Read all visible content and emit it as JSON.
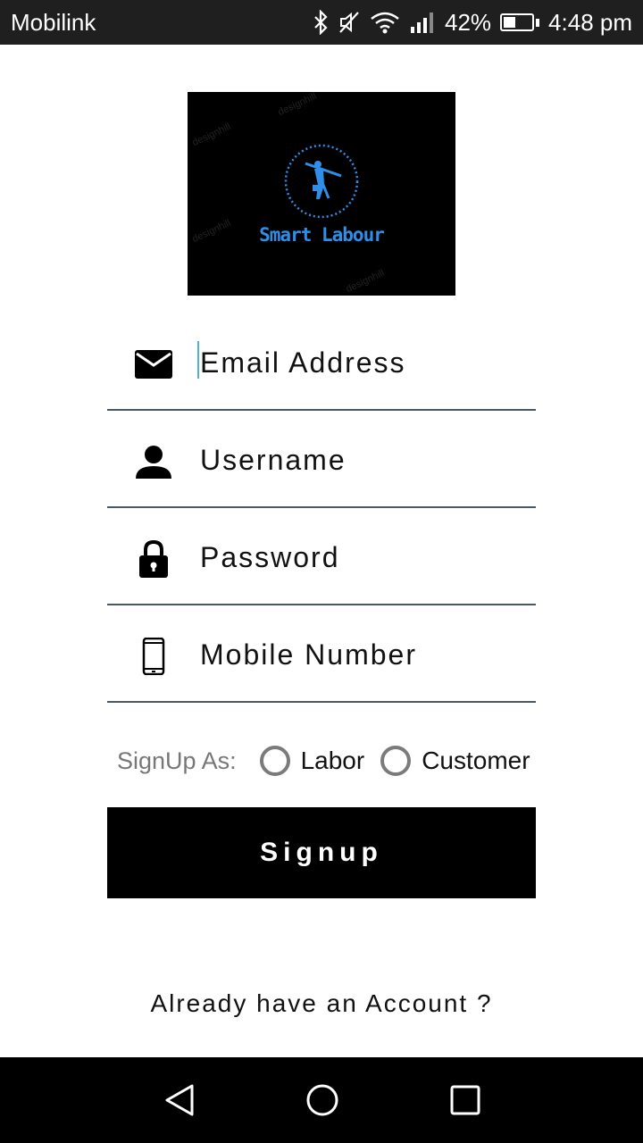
{
  "status_bar": {
    "carrier": "Mobilink",
    "battery_percent": "42%",
    "battery_level": 0.42,
    "time": "4:48 pm",
    "icons": [
      "bluetooth-icon",
      "mute-icon",
      "wifi-icon",
      "signal-icon",
      "battery-icon"
    ]
  },
  "logo": {
    "text": "Smart Labour",
    "watermark": "designhill",
    "accent_color": "#2f8fe8"
  },
  "form": {
    "email_placeholder": "Email Address",
    "username_placeholder": "Username",
    "password_placeholder": "Password",
    "mobile_placeholder": "Mobile Number",
    "signup_as_label": "SignUp As:",
    "option_labor": "Labor",
    "option_customer": "Customer",
    "signup_button": "Signup",
    "already_account": "Already have an Account ?"
  },
  "nav_bar": {
    "icons": [
      "back-icon",
      "home-icon",
      "recents-icon"
    ]
  }
}
